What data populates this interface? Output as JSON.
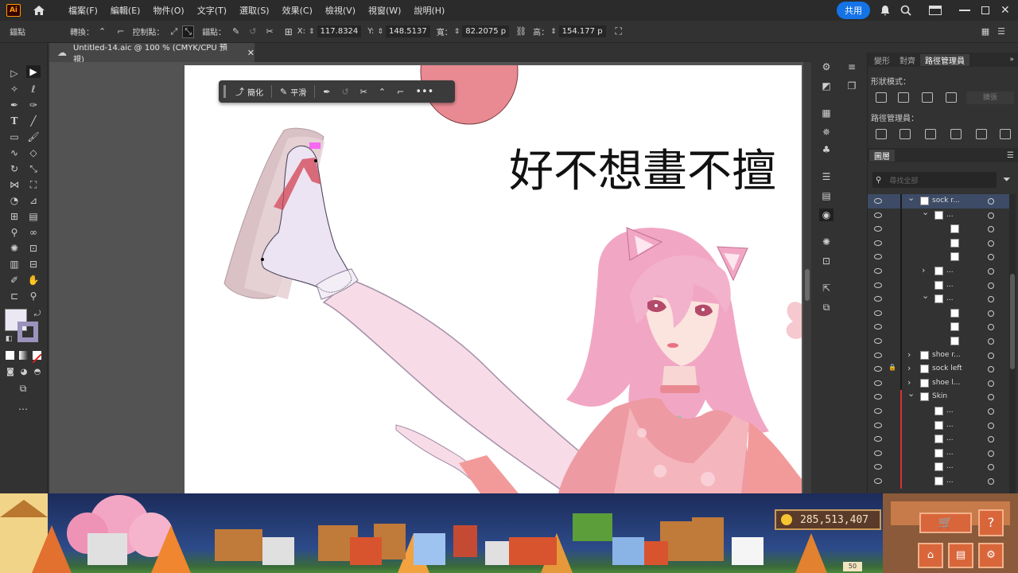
{
  "menubar": {
    "logo": "Ai",
    "items": [
      "檔案(F)",
      "編輯(E)",
      "物件(O)",
      "文字(T)",
      "選取(S)",
      "效果(C)",
      "檢視(V)",
      "視窗(W)",
      "說明(H)"
    ],
    "share": "共用"
  },
  "controlbar": {
    "mode": "錨點",
    "convert": "轉換：",
    "handles": "控制點：",
    "anchors": "錨點：",
    "x_label": "X:",
    "x_value": "117.8324",
    "y_label": "Y:",
    "y_value": "148.5137",
    "w_label": "寬：",
    "w_value": "82.2075 p",
    "h_label": "高：",
    "h_value": "154.177 p"
  },
  "doc_tab": {
    "title": "Untitled-14.aic @ 100 % (CMYK/CPU 預視)"
  },
  "context_bar": {
    "simplify": "簡化",
    "smooth": "平滑"
  },
  "artwork": {
    "headline": "好不想畫不擅"
  },
  "panel": {
    "tabs": [
      "變形",
      "對齊",
      "路徑管理員"
    ],
    "shape_modes": "形狀模式：",
    "expand": "擴張",
    "pathfinders": "路徑管理員：",
    "layers_tab": "圖層",
    "search_placeholder": "尋找全部",
    "layers": [
      {
        "name": "sock r...",
        "indent": 0,
        "expanded": true
      },
      {
        "name": "...",
        "indent": 1,
        "expanded": true
      },
      {
        "name": "",
        "indent": 2
      },
      {
        "name": "",
        "indent": 2
      },
      {
        "name": "",
        "indent": 2
      },
      {
        "name": "...",
        "indent": 1,
        "expanded": false
      },
      {
        "name": "...",
        "indent": 1
      },
      {
        "name": "...",
        "indent": 1,
        "expanded": true
      },
      {
        "name": "",
        "indent": 2
      },
      {
        "name": "",
        "indent": 2
      },
      {
        "name": "",
        "indent": 2
      },
      {
        "name": "shoe r...",
        "indent": 0,
        "expanded": false
      },
      {
        "name": "sock left",
        "indent": 0,
        "expanded": false,
        "locked": true
      },
      {
        "name": "shoe l...",
        "indent": 0,
        "expanded": false
      },
      {
        "name": "Skin",
        "indent": 0,
        "expanded": true
      },
      {
        "name": "...",
        "indent": 1
      },
      {
        "name": "...",
        "indent": 1
      },
      {
        "name": "...",
        "indent": 1
      },
      {
        "name": "...",
        "indent": 1
      },
      {
        "name": "...",
        "indent": 1
      },
      {
        "name": "...",
        "indent": 1
      }
    ]
  },
  "game": {
    "coins": "285,513,407",
    "level": "50"
  },
  "colors": {
    "accent": "#1473e6",
    "selection": "#ff3cff",
    "skin_layer": "#d13434"
  }
}
